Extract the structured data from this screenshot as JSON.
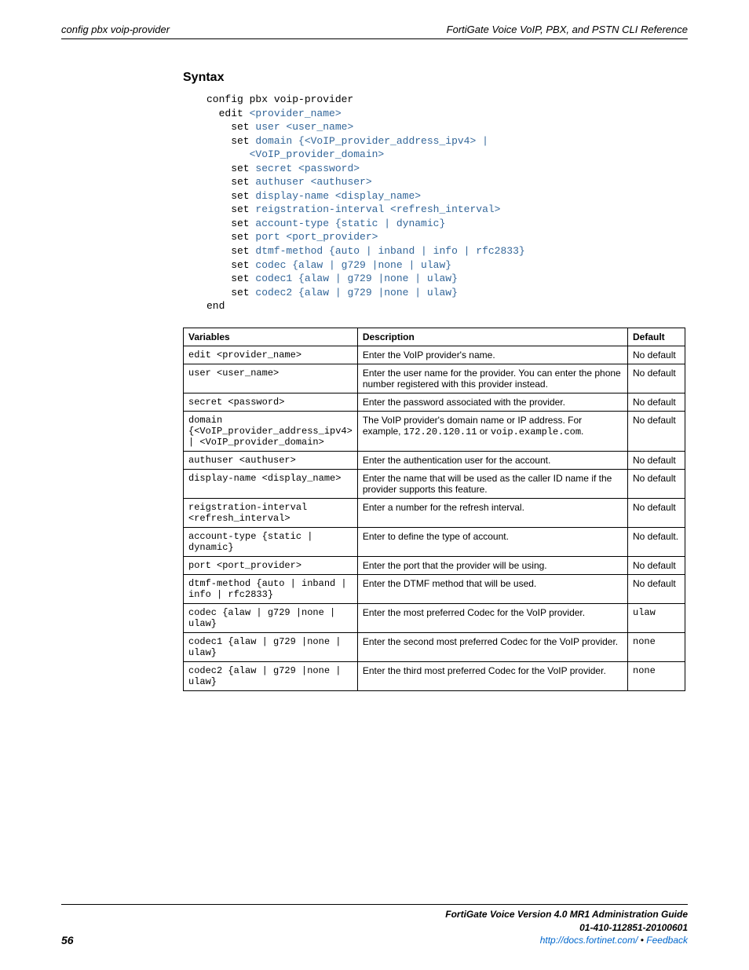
{
  "header": {
    "left": "config pbx voip-provider",
    "right": "FortiGate Voice VoIP, PBX, and PSTN CLI Reference"
  },
  "syntax_heading": "Syntax",
  "code_html": "config pbx voip-provider\n  edit <span class=\"kw\">&lt;provider_name&gt;</span>\n    set <span class=\"kw\">user &lt;user_name&gt;</span>\n    set <span class=\"kw\">domain {&lt;VoIP_provider_address_ipv4&gt; |</span>\n       <span class=\"kw\">&lt;VoIP_provider_domain&gt;</span>\n    set <span class=\"kw\">secret &lt;password&gt;</span>\n    set <span class=\"kw\">authuser &lt;authuser&gt;</span>\n    set <span class=\"kw\">display-name &lt;display_name&gt;</span>\n    set <span class=\"kw\">reigstration-interval &lt;refresh_interval&gt;</span>\n    set <span class=\"kw\">account-type {static | dynamic}</span>\n    set <span class=\"kw\">port &lt;port_provider&gt;</span>\n    set <span class=\"kw\">dtmf-method {auto | inband | info | rfc2833}</span>\n    set <span class=\"kw\">codec {alaw | g729 |none | ulaw}</span>\n    set <span class=\"kw\">codec1 {alaw | g729 |none | ulaw}</span>\n    set <span class=\"kw\">codec2 {alaw | g729 |none | ulaw}</span>\nend",
  "table": {
    "headers": [
      "Variables",
      "Description",
      "Default"
    ],
    "rows": [
      {
        "var": "edit <provider_name>",
        "desc": "Enter the VoIP provider's name.",
        "def": "No default"
      },
      {
        "var": "user <user_name>",
        "desc": "Enter the user name for the provider. You can enter the phone number registered with this provider instead.",
        "def": "No default"
      },
      {
        "var": "secret <password>",
        "desc": "Enter the password associated with the provider.",
        "def": "No default"
      },
      {
        "var": "domain {<VoIP_provider_address_ipv4> | <VoIP_provider_domain>",
        "desc_html": "The VoIP provider's domain name or IP address. For example, <span class=\"mono\">172.20.120.11</span> or <span class=\"mono\">voip.example.com</span>.",
        "def": "No default"
      },
      {
        "var": "authuser <authuser>",
        "desc": "Enter the authentication user for the account.",
        "def": "No default"
      },
      {
        "var": "display-name <display_name>",
        "desc": "Enter the name that will be used as the caller ID name if the provider supports this feature.",
        "def": "No default"
      },
      {
        "var": "reigstration-interval <refresh_interval>",
        "desc": "Enter a number for the refresh interval.",
        "def": "No default"
      },
      {
        "var": "account-type {static | dynamic}",
        "desc": "Enter to define the type of account.",
        "def": "No default."
      },
      {
        "var": "port <port_provider>",
        "desc": "Enter the port that the provider will be using.",
        "def": "No default"
      },
      {
        "var": "dtmf-method {auto | inband | info | rfc2833}",
        "desc": "Enter the DTMF method that will be used.",
        "def": "No default"
      },
      {
        "var": "codec {alaw | g729 |none | ulaw}",
        "desc": "Enter the most preferred Codec for the VoIP provider.",
        "def_mono": "ulaw"
      },
      {
        "var": "codec1 {alaw | g729 |none | ulaw}",
        "desc": "Enter the second most preferred Codec for the VoIP provider.",
        "def_mono": "none"
      },
      {
        "var": "codec2 {alaw | g729 |none | ulaw}",
        "desc": "Enter the third most preferred Codec for the VoIP provider.",
        "def_mono": "none"
      }
    ]
  },
  "footer": {
    "page": "56",
    "line1": "FortiGate Voice Version 4.0 MR1 Administration Guide",
    "line2": "01-410-112851-20100601",
    "link": "http://docs.fortinet.com/",
    "bullet": " • ",
    "feedback": "Feedback"
  }
}
